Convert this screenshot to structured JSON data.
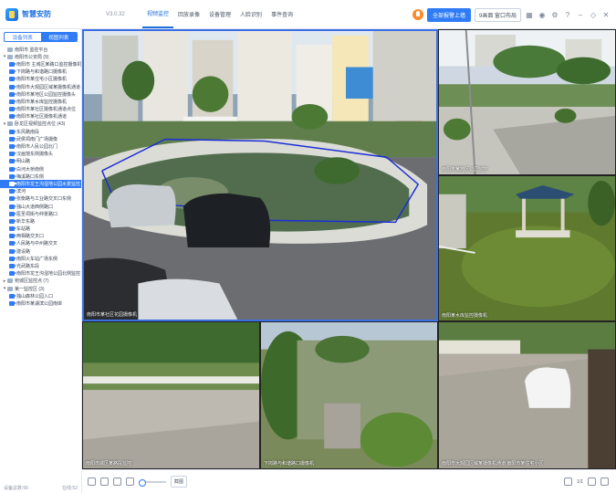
{
  "app": {
    "title": "智慧安防",
    "version": "V3.0.32",
    "nav": [
      "视频监控",
      "回放录像",
      "设备管理",
      "人脸识别",
      "事件查询"
    ],
    "alarm_btn": "全部报警上墙",
    "layout_btn": "9画面 窗口布局",
    "accent": "#2f7cf6"
  },
  "sidebar": {
    "tabs": [
      "设备列表",
      "视图列表"
    ],
    "items": [
      {
        "label": "南阳市 监控平台",
        "type": "folder",
        "caret": ""
      },
      {
        "label": "南阳市公安局 (9)",
        "type": "folder",
        "caret": "▾"
      },
      {
        "label": "南阳市 主城区某路口监控摄像机",
        "type": "cam"
      },
      {
        "label": "下岗路与和谐路口摄像机",
        "type": "cam"
      },
      {
        "label": "南阳市某住宅小区摄像机",
        "type": "cam"
      },
      {
        "label": "南阳市大观园区域某摄像机通道",
        "type": "cam"
      },
      {
        "label": "南阳市某地区公园监控摄像头",
        "type": "cam"
      },
      {
        "label": "南阳市某水库监控摄像机",
        "type": "cam"
      },
      {
        "label": "南阳市某社区摄像机通道点位",
        "type": "cam"
      },
      {
        "label": "南阳市某社区摄像机通道",
        "type": "cam"
      },
      {
        "label": "卧龙区视频监控点位 (43)",
        "type": "folder",
        "caret": "▾"
      },
      {
        "label": "东风路南段",
        "type": "cam"
      },
      {
        "label": "武侯祠南门广场摄像",
        "type": "cam"
      },
      {
        "label": "南阳市人民公园北门",
        "type": "cam"
      },
      {
        "label": "汉画馆东侧摄像头",
        "type": "cam"
      },
      {
        "label": "明山路",
        "type": "cam"
      },
      {
        "label": "白河大桥南侧",
        "type": "cam"
      },
      {
        "label": "梅溪路口东侧",
        "type": "cam"
      },
      {
        "label": "南阳市龙王沟湿地公园水景监控",
        "type": "cam",
        "selected": true
      },
      {
        "label": "滨河",
        "type": "cam"
      },
      {
        "label": "张衡路与工业路交叉口东侧",
        "type": "cam"
      },
      {
        "label": "独山大道西侧路口",
        "type": "cam"
      },
      {
        "label": "医圣祠街与仲景路口",
        "type": "cam"
      },
      {
        "label": "新华东路",
        "type": "cam"
      },
      {
        "label": "车站路",
        "type": "cam"
      },
      {
        "label": "两相路交叉口",
        "type": "cam"
      },
      {
        "label": "人民路与中州路交叉",
        "type": "cam"
      },
      {
        "label": "建设路",
        "type": "cam"
      },
      {
        "label": "南阳火车站广场东侧",
        "type": "cam"
      },
      {
        "label": "光武路东段",
        "type": "cam"
      },
      {
        "label": "南阳市龙王沟湿地公园北侧监控",
        "type": "cam"
      },
      {
        "label": "宛城区监控点 (7)",
        "type": "folder",
        "caret": "▸"
      },
      {
        "label": "第一监控区 (3)",
        "type": "folder",
        "caret": "▾"
      },
      {
        "label": "独山森林公园入口",
        "type": "cam"
      },
      {
        "label": "南阳市某湖滨公园南岸",
        "type": "cam"
      }
    ],
    "footer_left": "设备总数:56",
    "footer_right": "在线:52"
  },
  "tiles": [
    {
      "id": "main",
      "label": "南阳市某社区花园摄像机"
    },
    {
      "id": "tr",
      "label": "南阳市某地区公园监控"
    },
    {
      "id": "mr",
      "label": "南阳某水库监控摄像机"
    },
    {
      "id": "bl",
      "label": "南阳市城区某路段监控"
    },
    {
      "id": "bm",
      "label": "下岗路与和谐路口摄像机"
    },
    {
      "id": "br",
      "label": "南阳市大观园区域某摄像机通道 南阳市某住宅小区"
    }
  ],
  "controls": {
    "capture_label": "截图",
    "page": "1/1"
  }
}
